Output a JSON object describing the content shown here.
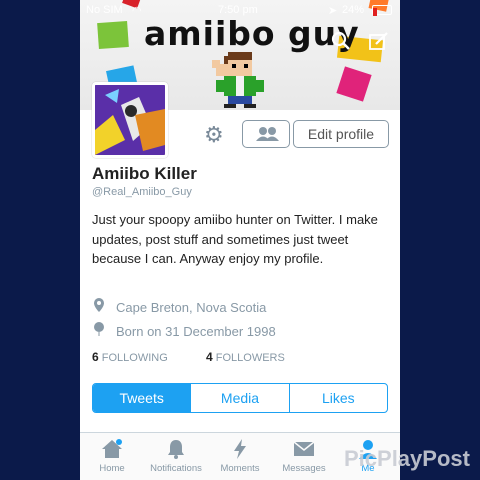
{
  "status_bar": {
    "carrier": "No SIM",
    "time": "7:50 pm",
    "battery": "24%"
  },
  "banner": {
    "title": "amiibo guy"
  },
  "header_icons": [
    "search-icon",
    "compose-icon"
  ],
  "profile": {
    "edit_label": "Edit profile",
    "name": "Amiibo Killer",
    "handle": "@Real_Amiibo_Guy",
    "bio": "Just your spoopy amiibo hunter on Twitter. I make updates, post stuff and sometimes just tweet because I can. Anyway enjoy my profile.",
    "location": "Cape Breton, Nova Scotia",
    "birthday": "Born on 31 December 1998",
    "following_count": "6",
    "following_label": "FOLLOWING",
    "followers_count": "4",
    "followers_label": "FOLLOWERS"
  },
  "tabs": [
    {
      "label": "Tweets",
      "active": true
    },
    {
      "label": "Media",
      "active": false
    },
    {
      "label": "Likes",
      "active": false
    }
  ],
  "tab_bar": [
    {
      "label": "Home",
      "icon": "home-icon"
    },
    {
      "label": "Notifications",
      "icon": "bell-icon"
    },
    {
      "label": "Moments",
      "icon": "lightning-icon"
    },
    {
      "label": "Messages",
      "icon": "envelope-icon"
    },
    {
      "label": "Me",
      "icon": "person-icon",
      "active": true
    }
  ],
  "watermark": "PicPlayPost",
  "colors": {
    "accent": "#1da1f2",
    "background": "#0b1a4a",
    "muted": "#8899a6"
  }
}
